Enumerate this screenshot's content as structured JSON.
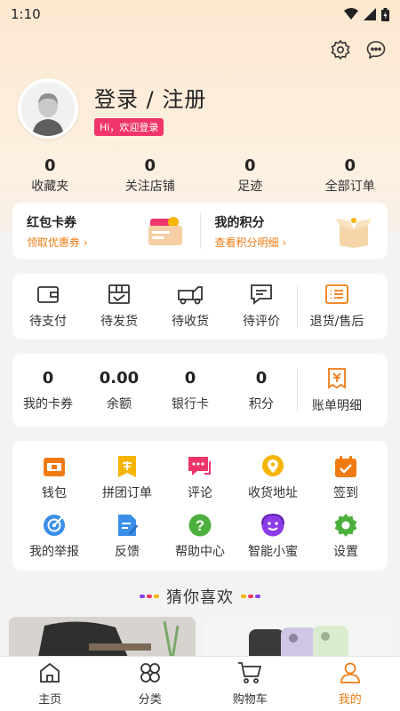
{
  "status_bar": {
    "time": "1:10"
  },
  "profile": {
    "login_text": "登录 / 注册",
    "welcome": "Hi，欢迎登录"
  },
  "stats": [
    {
      "value": "0",
      "label": "收藏夹"
    },
    {
      "value": "0",
      "label": "关注店铺"
    },
    {
      "value": "0",
      "label": "足迹"
    },
    {
      "value": "0",
      "label": "全部订单"
    }
  ],
  "promo": {
    "red_packet": {
      "title": "红包卡券",
      "subtitle": "领取优惠券"
    },
    "points": {
      "title": "我的积分",
      "subtitle": "查看积分明细"
    }
  },
  "orders": [
    {
      "label": "待支付",
      "icon": "wallet-icon"
    },
    {
      "label": "待发货",
      "icon": "package-icon"
    },
    {
      "label": "待收货",
      "icon": "truck-icon"
    },
    {
      "label": "待评价",
      "icon": "chat-icon"
    },
    {
      "label": "退货/售后",
      "icon": "return-list-icon"
    }
  ],
  "wallet": [
    {
      "value": "0",
      "label": "我的卡券"
    },
    {
      "value": "0.00",
      "label": "余额"
    },
    {
      "value": "0",
      "label": "银行卡"
    },
    {
      "value": "0",
      "label": "积分"
    }
  ],
  "bill": {
    "label": "账单明细"
  },
  "services": [
    {
      "label": "钱包",
      "icon": "wallet-icon",
      "color": "#f07b13"
    },
    {
      "label": "拼团订单",
      "icon": "group-buy-icon",
      "color": "#f5b400"
    },
    {
      "label": "评论",
      "icon": "comment-icon",
      "color": "#f0356a"
    },
    {
      "label": "收货地址",
      "icon": "location-icon",
      "color": "#f5b400"
    },
    {
      "label": "签到",
      "icon": "calendar-check-icon",
      "color": "#f07b13"
    },
    {
      "label": "我的举报",
      "icon": "report-icon",
      "color": "#3b8fe8"
    },
    {
      "label": "反馈",
      "icon": "feedback-icon",
      "color": "#3b8fe8"
    },
    {
      "label": "帮助中心",
      "icon": "help-icon",
      "color": "#4cb13c"
    },
    {
      "label": "智能小蜜",
      "icon": "assistant-icon",
      "color": "#8b3be8"
    },
    {
      "label": "设置",
      "icon": "settings-icon",
      "color": "#4cb13c"
    }
  ],
  "guess": {
    "title": "猜你喜欢"
  },
  "bottom_nav": [
    {
      "label": "主页",
      "icon": "home-icon",
      "active": false
    },
    {
      "label": "分类",
      "icon": "category-icon",
      "active": false
    },
    {
      "label": "购物车",
      "icon": "cart-icon",
      "active": false
    },
    {
      "label": "我的",
      "icon": "profile-icon",
      "active": true
    }
  ],
  "colors": {
    "accent": "#f07b13",
    "badge": "#f0356a"
  }
}
